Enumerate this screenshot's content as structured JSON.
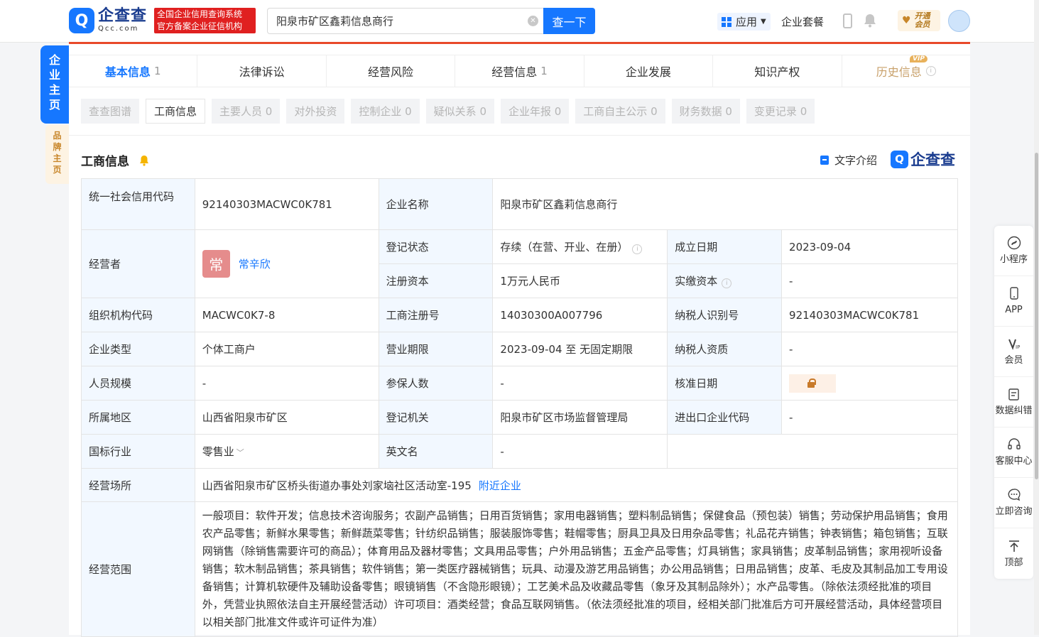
{
  "header": {
    "logo_mark": "Q",
    "logo_cn": "企查查",
    "logo_en": "Qcc.com",
    "slogan_line1": "全国企业信用查询系统",
    "slogan_line2": "官方备案企业征信机构",
    "search_value": "阳泉市矿区鑫莉信息商行",
    "search_button": "查一下",
    "apps_label": "应用",
    "suite_label": "企业套餐",
    "vip_line1": "开通",
    "vip_line2": "会员"
  },
  "side_tabs": {
    "main": [
      "企",
      "业",
      "主",
      "页"
    ],
    "brand": [
      "品",
      "牌",
      "主",
      "页"
    ]
  },
  "tabs": [
    {
      "label": "基本信息",
      "count": "1"
    },
    {
      "label": "法律诉讼",
      "count": ""
    },
    {
      "label": "经营风险",
      "count": ""
    },
    {
      "label": "经营信息",
      "count": "1"
    },
    {
      "label": "企业发展",
      "count": ""
    },
    {
      "label": "知识产权",
      "count": ""
    },
    {
      "label": "历史信息",
      "count": ""
    }
  ],
  "vip_tag": "VIP",
  "subtabs": [
    "查查图谱",
    "工商信息",
    "主要人员 0",
    "对外投资",
    "控制企业 0",
    "疑似关系 0",
    "企业年报 0",
    "工商自主公示 0",
    "财务数据 0",
    "变更记录 0"
  ],
  "section": {
    "title": "工商信息",
    "text_intro": "文字介绍",
    "brand_mark": "Q",
    "brand_text": "企查查"
  },
  "info": {
    "credit_code_label": "统一社会信用代码",
    "credit_code": "92140303MACWC0K781",
    "company_name_label": "企业名称",
    "company_name": "阳泉市矿区鑫莉信息商行",
    "operator_label": "经营者",
    "operator_avatar": "常",
    "operator_name": "常辛欣",
    "reg_status_label": "登记状态",
    "reg_status": "存续（在营、开业、在册）",
    "found_date_label": "成立日期",
    "found_date": "2023-09-04",
    "reg_capital_label": "注册资本",
    "reg_capital": "1万元人民币",
    "paid_capital_label": "实缴资本",
    "paid_capital": "-",
    "org_code_label": "组织机构代码",
    "org_code": "MACWC0K7-8",
    "reg_no_label": "工商注册号",
    "reg_no": "14030300A007796",
    "taxpayer_id_label": "纳税人识别号",
    "taxpayer_id": "92140303MACWC0K781",
    "company_type_label": "企业类型",
    "company_type": "个体工商户",
    "term_label": "营业期限",
    "term": "2023-09-04 至 无固定期限",
    "taxpayer_qual_label": "纳税人资质",
    "taxpayer_qual": "-",
    "staff_size_label": "人员规模",
    "staff_size": "-",
    "insured_label": "参保人数",
    "insured": "-",
    "approve_date_label": "核准日期",
    "region_label": "所属地区",
    "region": "山西省阳泉市矿区",
    "authority_label": "登记机关",
    "authority": "阳泉市矿区市场监督管理局",
    "import_export_label": "进出口企业代码",
    "import_export": "-",
    "industry_label": "国标行业",
    "industry": "零售业",
    "english_name_label": "英文名",
    "english_name": "-",
    "address_label": "经营场所",
    "address": "山西省阳泉市矿区桥头街道办事处刘家垴社区活动室-195",
    "nearby_link": "附近企业",
    "scope_label": "经营范围",
    "scope": "一般项目：软件开发；信息技术咨询服务；农副产品销售；日用百货销售；家用电器销售；塑料制品销售；保健食品（预包装）销售；劳动保护用品销售；食用农产品零售；新鲜水果零售；新鲜蔬菜零售；针纺织品销售；服装服饰零售；鞋帽零售；厨具卫具及日用杂品零售；礼品花卉销售；钟表销售；箱包销售；互联网销售（除销售需要许可的商品）；体育用品及器材零售；文具用品零售；户外用品销售；五金产品零售；灯具销售；家具销售；皮革制品销售；家用视听设备销售；软木制品销售；茶具销售；软件销售；第一类医疗器械销售；玩具、动漫及游艺用品销售；办公用品销售；日用品销售；皮革、毛皮及其制品加工专用设备销售；计算机软硬件及辅助设备零售；眼镜销售（不含隐形眼镜）；工艺美术品及收藏品零售（象牙及其制品除外）；水产品零售。（除依法须经批准的项目外，凭营业执照依法自主开展经营活动）许可项目：酒类经营；食品互联网销售。（依法须经批准的项目，经相关部门批准后方可开展经营活动，具体经营项目以相关部门批准文件或许可证件为准）"
  },
  "float_menu": [
    {
      "label": "小程序",
      "icon": "miniprogram-icon"
    },
    {
      "label": "APP",
      "icon": "phone-icon"
    },
    {
      "label": "会员",
      "icon": "vip-icon"
    },
    {
      "label": "数据纠错",
      "icon": "edit-icon"
    },
    {
      "label": "客服中心",
      "icon": "headset-icon"
    },
    {
      "label": "立即咨询",
      "icon": "chat-icon"
    },
    {
      "label": "顶部",
      "icon": "arrow-up-icon"
    }
  ],
  "colors": {
    "brand_blue": "#1677ff",
    "accent_red": "#e8492a",
    "vip_gold": "#c8862a"
  }
}
